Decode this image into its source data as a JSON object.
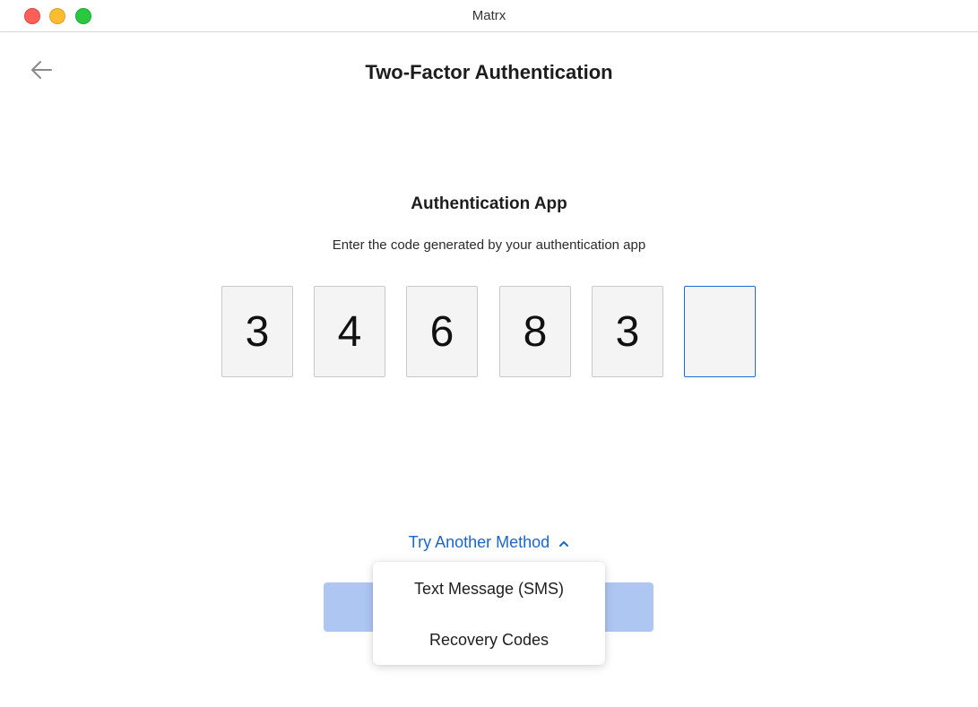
{
  "window": {
    "title": "Matrx"
  },
  "header": {
    "back_icon": "arrow-left-icon",
    "title": "Two-Factor Authentication"
  },
  "auth_app": {
    "title": "Authentication App",
    "description": "Enter the code generated by your authentication app",
    "code_digits": [
      "3",
      "4",
      "6",
      "8",
      "3",
      ""
    ]
  },
  "alternate": {
    "link_label": "Try Another Method",
    "chevron_icon": "chevron-up-icon",
    "options": [
      "Text Message (SMS)",
      "Recovery Codes"
    ]
  },
  "colors": {
    "link": "#1a66cc",
    "active_border": "#1a6fd6",
    "button_disabled": "#adc6f2"
  }
}
